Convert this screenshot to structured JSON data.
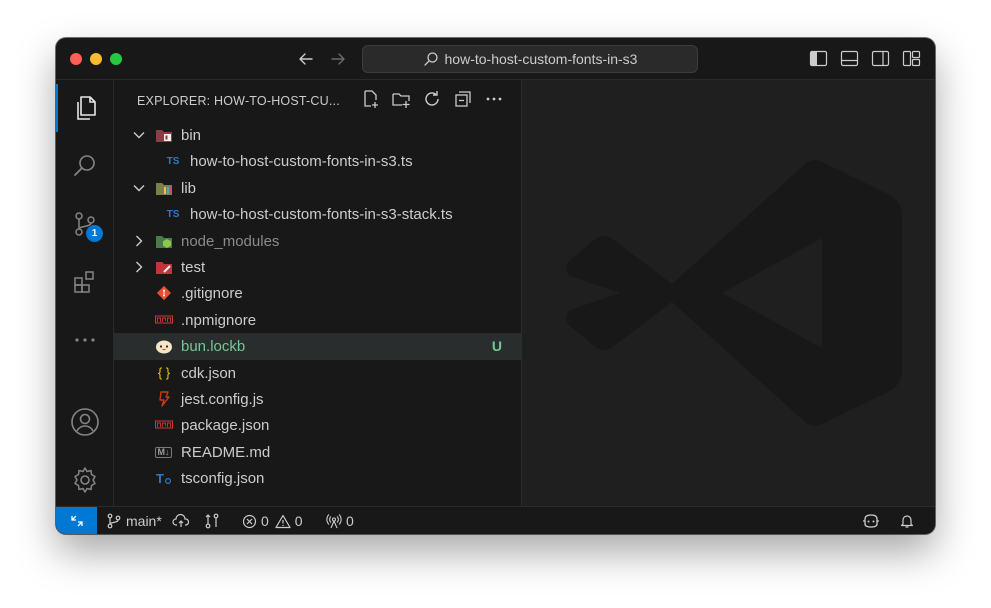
{
  "titlebar": {
    "search_text": "how-to-host-custom-fonts-in-s3"
  },
  "explorer": {
    "title": "EXPLORER: HOW-TO-HOST-CU..."
  },
  "tree": [
    {
      "label": "bin",
      "type": "folder",
      "expanded": true,
      "level": 0
    },
    {
      "label": "how-to-host-custom-fonts-in-s3.ts",
      "type": "ts",
      "level": 1,
      "icon_text": "TS"
    },
    {
      "label": "lib",
      "type": "folder",
      "expanded": true,
      "level": 0
    },
    {
      "label": "how-to-host-custom-fonts-in-s3-stack.ts",
      "type": "ts",
      "level": 1,
      "icon_text": "TS"
    },
    {
      "label": "node_modules",
      "type": "folder",
      "expanded": false,
      "level": 0
    },
    {
      "label": "test",
      "type": "folder",
      "expanded": false,
      "level": 0
    },
    {
      "label": ".gitignore",
      "type": "file",
      "level": 0
    },
    {
      "label": ".npmignore",
      "type": "file",
      "level": 0
    },
    {
      "label": "bun.lockb",
      "type": "file",
      "level": 0,
      "git_status": "U"
    },
    {
      "label": "cdk.json",
      "type": "file",
      "level": 0,
      "icon_text": "{ }"
    },
    {
      "label": "jest.config.js",
      "type": "file",
      "level": 0
    },
    {
      "label": "package.json",
      "type": "file",
      "level": 0
    },
    {
      "label": "README.md",
      "type": "file",
      "level": 0,
      "icon_text": "M↓"
    },
    {
      "label": "tsconfig.json",
      "type": "file",
      "level": 0,
      "icon_text": "T"
    }
  ],
  "activity": {
    "source_control_badge": "1"
  },
  "statusbar": {
    "branch": "main*",
    "errors": "0",
    "warnings": "0",
    "ports": "0"
  },
  "colors": {
    "accent": "#0078d4",
    "untracked": "#73c991",
    "background": "#1f1f1f",
    "sidebar": "#181818"
  }
}
